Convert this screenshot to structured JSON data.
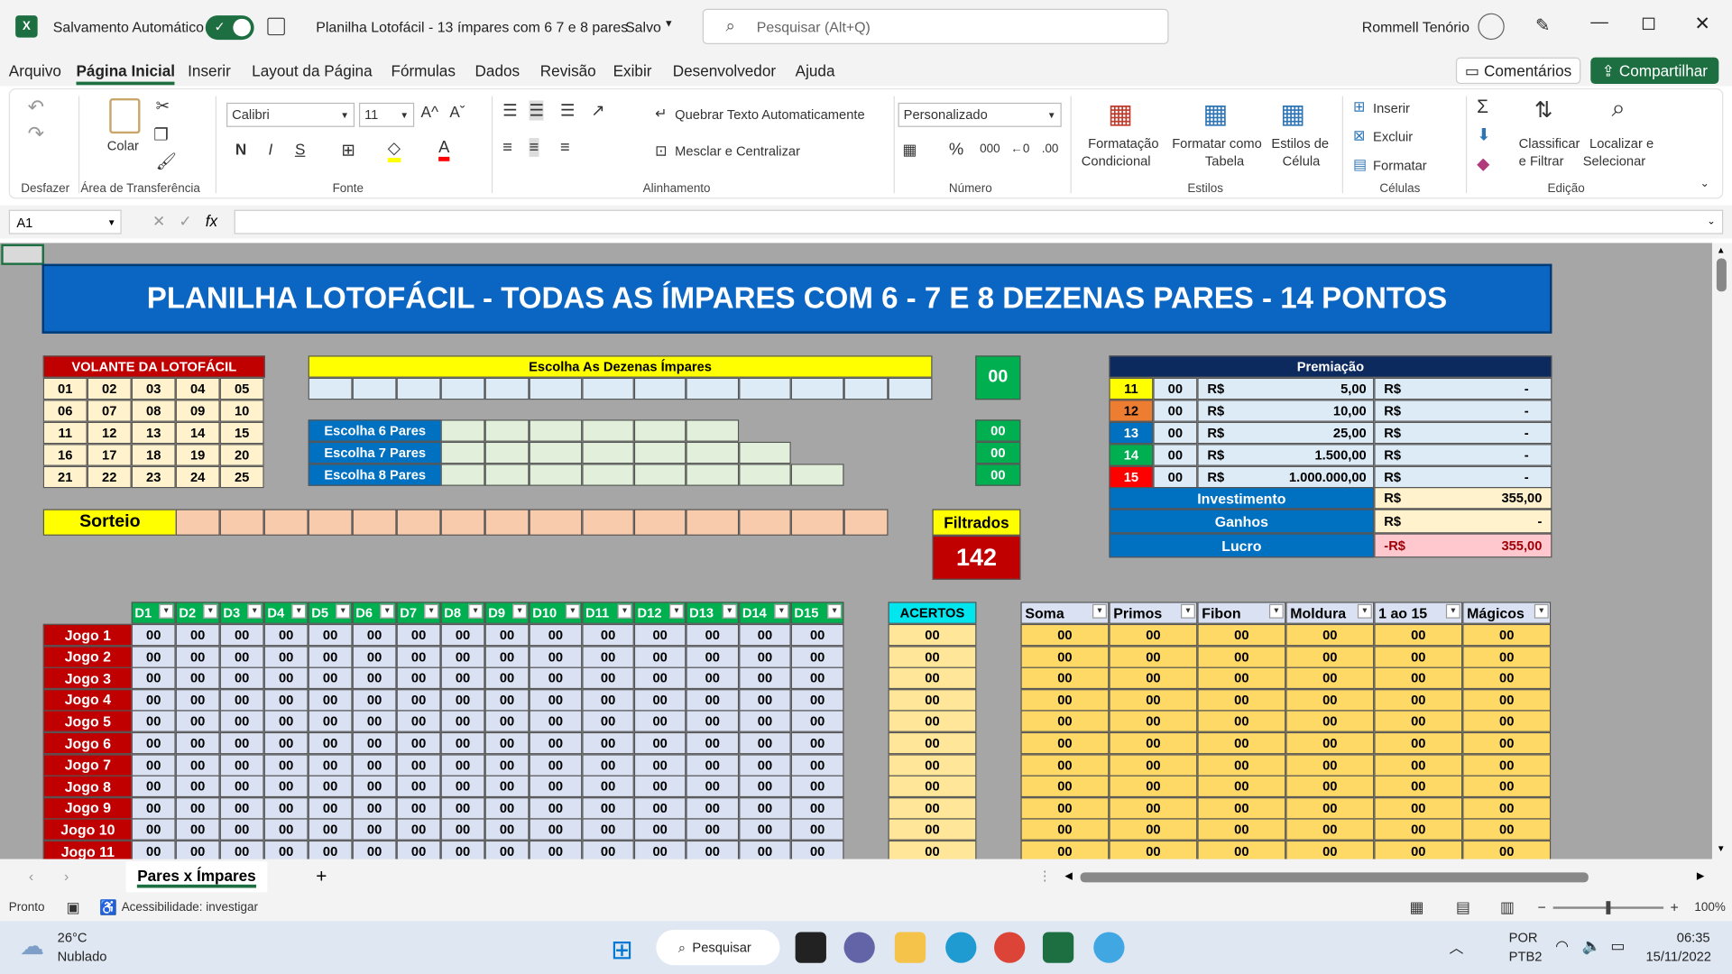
{
  "titlebar": {
    "autosave_label": "Salvamento Automático",
    "doc_title": "Planilha Lotofácil - 13 ímpares com 6 7 e 8 pares",
    "save_status": "Salvo",
    "search_placeholder": "Pesquisar (Alt+Q)",
    "user": "Rommell Tenório"
  },
  "menu": [
    "Arquivo",
    "Página Inicial",
    "Inserir",
    "Layout da Página",
    "Fórmulas",
    "Dados",
    "Revisão",
    "Exibir",
    "Desenvolvedor",
    "Ajuda"
  ],
  "menu_right": {
    "comments": "Comentários",
    "share": "Compartilhar"
  },
  "ribbon": {
    "undo_label": "Desfazer",
    "paste_label": "Colar",
    "clipboard_label": "Área de Transferência",
    "font_name": "Calibri",
    "font_size": "11",
    "font_label": "Fonte",
    "bold": "N",
    "italic": "I",
    "underline": "S",
    "wrap_text": "Quebrar Texto Automaticamente",
    "merge_center": "Mesclar e Centralizar",
    "alignment_label": "Alinhamento",
    "number_format": "Personalizado",
    "number_label": "Número",
    "cond_format_1": "Formatação",
    "cond_format_2": "Condicional",
    "format_table_1": "Formatar como",
    "format_table_2": "Tabela",
    "cell_styles_1": "Estilos de",
    "cell_styles_2": "Célula",
    "styles_label": "Estilos",
    "insert": "Inserir",
    "delete": "Excluir",
    "format": "Formatar",
    "cells_label": "Células",
    "sort_1": "Classificar",
    "sort_2": "e Filtrar",
    "find_1": "Localizar e",
    "find_2": "Selecionar",
    "editing_label": "Edição"
  },
  "formula": {
    "namebox": "A1",
    "fx": "fx",
    "content": ""
  },
  "sheet": {
    "title": "PLANILHA LOTOFÁCIL - TODAS AS ÍMPARES COM 6 - 7 E 8 DEZENAS PARES - 14 PONTOS",
    "volante_title": "VOLANTE DA LOTOFÁCIL",
    "volante": [
      [
        "01",
        "02",
        "03",
        "04",
        "05"
      ],
      [
        "06",
        "07",
        "08",
        "09",
        "10"
      ],
      [
        "11",
        "12",
        "13",
        "14",
        "15"
      ],
      [
        "16",
        "17",
        "18",
        "19",
        "20"
      ],
      [
        "21",
        "22",
        "23",
        "24",
        "25"
      ]
    ],
    "impares_title": "Escolha As Dezenas Ímpares",
    "pares_rows": [
      "Escolha 6 Pares",
      "Escolha 7 Pares",
      "Escolha 8 Pares"
    ],
    "count_impares": "00",
    "count_pares": [
      "00",
      "00",
      "00"
    ],
    "sorteio": "Sorteio",
    "filtrados_label": "Filtrados",
    "filtrados_value": "142",
    "premiacao_title": "Premiação",
    "premiacao": [
      {
        "k": "11",
        "n": "00",
        "v": "5,00",
        "t": "-"
      },
      {
        "k": "12",
        "n": "00",
        "v": "10,00",
        "t": "-"
      },
      {
        "k": "13",
        "n": "00",
        "v": "25,00",
        "t": "-"
      },
      {
        "k": "14",
        "n": "00",
        "v": "1.500,00",
        "t": "-"
      },
      {
        "k": "15",
        "n": "00",
        "v": "1.000.000,00",
        "t": "-"
      }
    ],
    "currency": "R$",
    "investimento": {
      "label": "Investimento",
      "cur": "R$",
      "value": "355,00"
    },
    "ganhos": {
      "label": "Ganhos",
      "cur": "R$",
      "value": "-"
    },
    "lucro": {
      "label": "Lucro",
      "cur": "-R$",
      "value": "355,00"
    },
    "d_headers": [
      "D1",
      "D2",
      "D3",
      "D4",
      "D5",
      "D6",
      "D7",
      "D8",
      "D9",
      "D10",
      "D11",
      "D12",
      "D13",
      "D14",
      "D15"
    ],
    "acertos_header": "ACERTOS",
    "stat_headers": [
      "Soma",
      "Primos",
      "Fibon",
      "Moldura",
      "1 ao 15",
      "Mágicos"
    ],
    "jogos": [
      "Jogo 1",
      "Jogo 2",
      "Jogo 3",
      "Jogo 4",
      "Jogo 5",
      "Jogo 6",
      "Jogo 7",
      "Jogo 8",
      "Jogo 9",
      "Jogo 10",
      "Jogo 11"
    ],
    "zero": "00"
  },
  "tabs": {
    "active": "Pares x Ímpares",
    "add": "+"
  },
  "status": {
    "ready": "Pronto",
    "accessibility": "Acessibilidade: investigar",
    "zoom": "100%"
  },
  "taskbar": {
    "temp": "26°C",
    "weather": "Nublado",
    "search": "Pesquisar",
    "lang1": "POR",
    "lang2": "PTB2",
    "time": "06:35",
    "date": "15/11/2022"
  }
}
